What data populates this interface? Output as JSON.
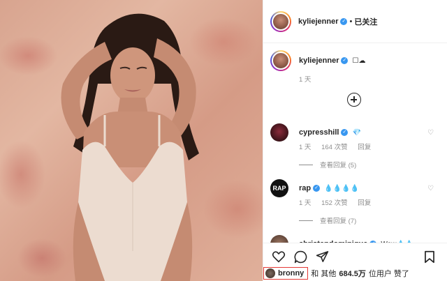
{
  "post_image": {
    "description_icon": "photo"
  },
  "header": {
    "username": "kyliejenner",
    "separator": "•",
    "follow_label": "已关注"
  },
  "caption": {
    "username": "kyliejenner",
    "text": "☐☁",
    "time": "1 天"
  },
  "comments": [
    {
      "username": "cypresshill",
      "text": "💎",
      "time": "1 天",
      "likes": "164 次赞",
      "reply": "回复",
      "view_replies": "查看回复 (5)"
    },
    {
      "username": "rap",
      "text": "💧💧💧💧",
      "time": "1 天",
      "likes": "152 次赞",
      "reply": "回复",
      "view_replies": "查看回复 (7)"
    },
    {
      "username": "christendominique",
      "text": "Wow💧💧"
    }
  ],
  "likes_line": {
    "username": "bronny",
    "middle": "和 其他",
    "count": "684.5万",
    "suffix": "位用户 赞了"
  },
  "colors": {
    "accent": "#3897f0",
    "highlight": "#e53935"
  }
}
